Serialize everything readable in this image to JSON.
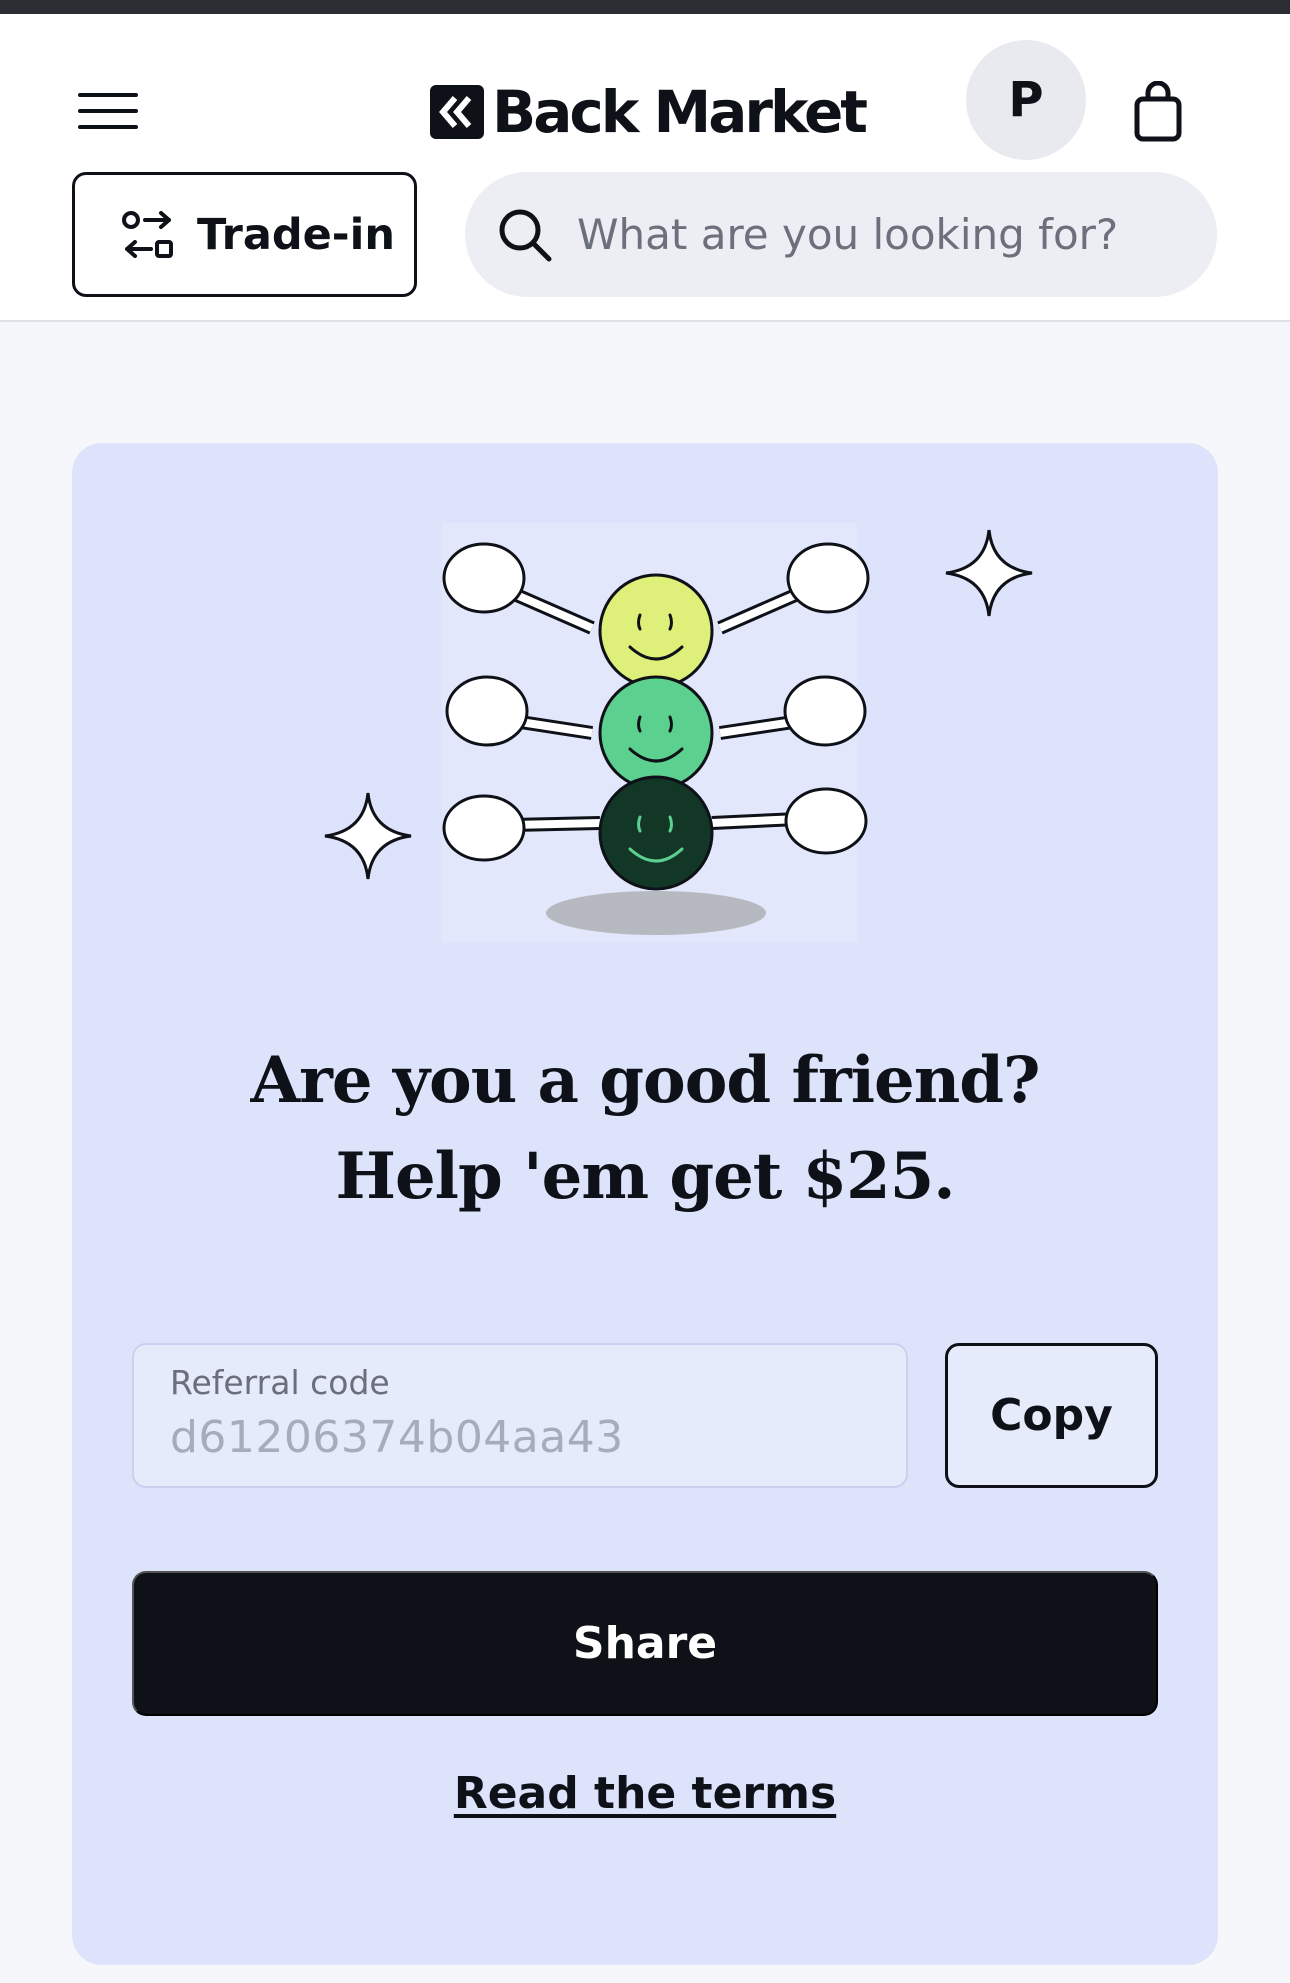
{
  "header": {
    "logo_text": "Back Market",
    "avatar_initial": "P",
    "tradein_label": "Trade-in",
    "search": {
      "placeholder": "What are you looking for?"
    }
  },
  "icons": {
    "menu": "hamburger-menu-icon",
    "logo": "back-market-logo-icon",
    "cart": "shopping-bag-icon",
    "tradein": "swap-arrows-icon",
    "search": "search-icon"
  },
  "referral": {
    "headline_line1": "Are you a good friend?",
    "headline_line2": "Help 'em get $25.",
    "code_label": "Referral code",
    "code_value": "d61206374b04aa43",
    "copy_label": "Copy",
    "share_label": "Share",
    "terms_label": "Read the terms"
  },
  "colors": {
    "card_background": "#dce3fa",
    "primary_button": "#0e1117",
    "smiley_top": "#dff07a",
    "smiley_middle": "#5cd08e",
    "smiley_bottom": "#123726"
  }
}
